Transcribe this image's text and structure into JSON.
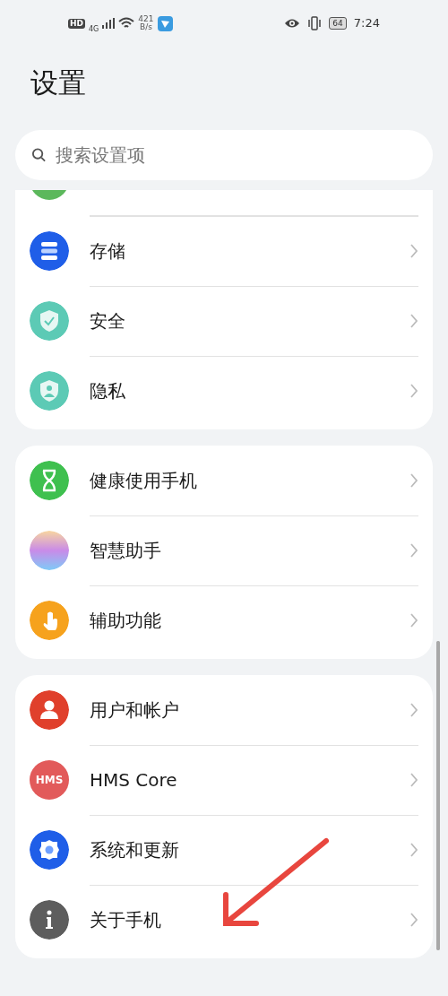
{
  "status_bar": {
    "hd": "HD",
    "network": "4G",
    "speed_value": "421",
    "speed_unit": "B/s",
    "battery": "64",
    "time": "7:24"
  },
  "title": "设置",
  "search": {
    "placeholder": "搜索设置项"
  },
  "groups": [
    {
      "items": [
        {
          "label": "存储",
          "kind": "storage"
        },
        {
          "label": "安全",
          "kind": "security"
        },
        {
          "label": "隐私",
          "kind": "privacy"
        }
      ]
    },
    {
      "items": [
        {
          "label": "健康使用手机",
          "kind": "hourglass"
        },
        {
          "label": "智慧助手",
          "kind": "assistant"
        },
        {
          "label": "辅助功能",
          "kind": "accessibility"
        }
      ]
    },
    {
      "items": [
        {
          "label": "用户和帐户",
          "kind": "user"
        },
        {
          "label": "HMS Core",
          "kind": "hms",
          "icon_text": "HMS"
        },
        {
          "label": "系统和更新",
          "kind": "system"
        },
        {
          "label": "关于手机",
          "kind": "about"
        }
      ]
    }
  ]
}
